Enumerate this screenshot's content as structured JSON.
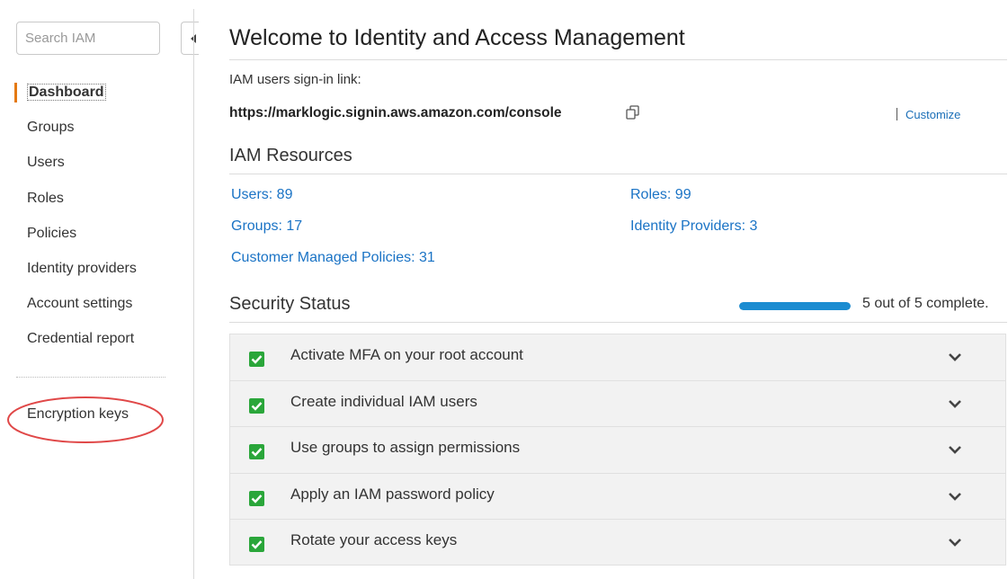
{
  "sidebar": {
    "search": {
      "placeholder": "Search IAM",
      "value": ""
    },
    "items": [
      {
        "label": "Dashboard",
        "active": true
      },
      {
        "label": "Groups"
      },
      {
        "label": "Users"
      },
      {
        "label": "Roles"
      },
      {
        "label": "Policies"
      },
      {
        "label": "Identity providers"
      },
      {
        "label": "Account settings"
      },
      {
        "label": "Credential report"
      }
    ],
    "encryption_keys": {
      "label": "Encryption keys",
      "highlight_color": "#e04848"
    }
  },
  "main": {
    "title": "Welcome to Identity and Access Management",
    "signin": {
      "label": "IAM users sign-in link:",
      "url": "https://marklogic.signin.aws.amazon.com/console",
      "copy_icon": "copy-icon",
      "customize_label": "Customize"
    },
    "resources": {
      "title": "IAM Resources",
      "links": {
        "users": "Users: 89",
        "roles": "Roles: 99",
        "groups": "Groups: 17",
        "identity_providers": "Identity Providers: 3",
        "customer_policies": "Customer Managed Policies: 31"
      }
    },
    "security": {
      "title": "Security Status",
      "progress_text": "5 out of 5 complete.",
      "progress_fraction": 1.0,
      "items": [
        {
          "label": "Activate MFA on your root account",
          "done": true
        },
        {
          "label": "Create individual IAM users",
          "done": true
        },
        {
          "label": "Use groups to assign permissions",
          "done": true
        },
        {
          "label": "Apply an IAM password policy",
          "done": true
        },
        {
          "label": "Rotate your access keys",
          "done": true
        }
      ]
    }
  },
  "colors": {
    "accent_active": "#e47911",
    "link": "#1a73c5",
    "progress": "#1b8cd1",
    "check": "#2aa63a"
  }
}
